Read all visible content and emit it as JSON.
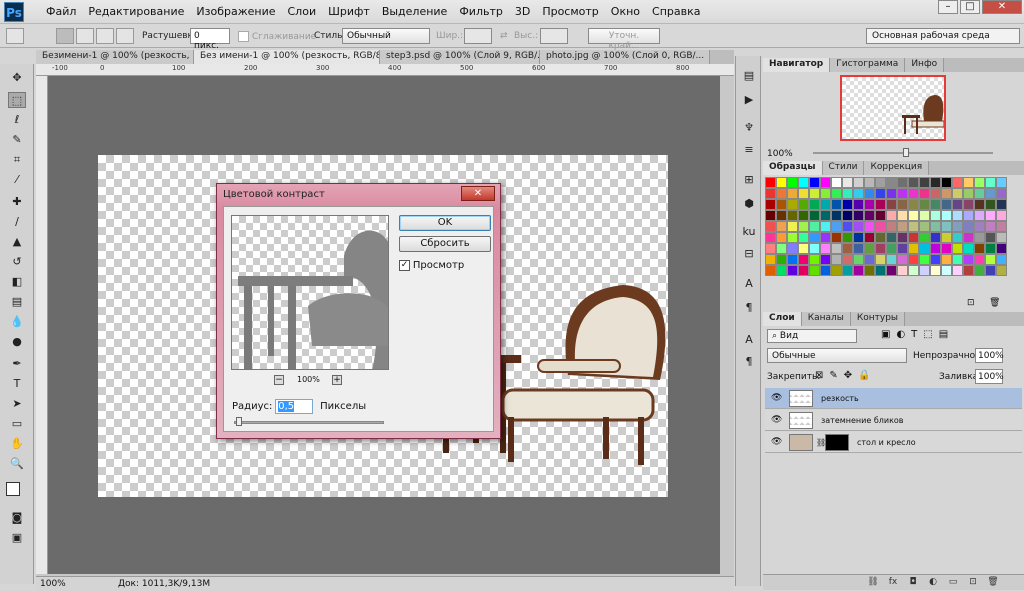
{
  "app": {
    "logo": "Ps"
  },
  "menu": [
    "Файл",
    "Редактирование",
    "Изображение",
    "Слои",
    "Шрифт",
    "Выделение",
    "Фильтр",
    "3D",
    "Просмотр",
    "Окно",
    "Справка"
  ],
  "window_controls": [
    "–",
    "□",
    "✕"
  ],
  "options_bar": {
    "feather_label": "Растушевка:",
    "feather_value": "0 пикс.",
    "antialias_label": "Сглаживание",
    "style_label": "Стиль:",
    "style_value": "Обычный",
    "width_label": "Шир.:",
    "height_label": "Выс.:",
    "refine_label": "Уточн. край...",
    "workspace": "Основная рабочая среда"
  },
  "doc_tabs": [
    "Безимени-1 @ 100% (резкость, ...",
    "Без имени-1 @ 100% (резкость, RGB/8) *",
    "step3.psd @ 100% (Слой 9, RGB/...",
    "photo.jpg @ 100% (Слой 0, RGB/..."
  ],
  "ruler_top_ticks": [
    "-100",
    "0",
    "100",
    "200",
    "300",
    "400",
    "500",
    "600",
    "700",
    "800"
  ],
  "status": {
    "zoom": "100%",
    "doc_info": "Док: 1011,3K/9,13M"
  },
  "dialog": {
    "title": "Цветовой контраст",
    "ok": "OK",
    "reset": "Сбросить",
    "preview_label": "Просмотр",
    "preview_checked": "✓",
    "zoom": "100%",
    "radius_label": "Радиус:",
    "radius_value": "0,5",
    "radius_unit": "Пикселы"
  },
  "navigator": {
    "tabs": [
      "Навигатор",
      "Гистограмма",
      "Инфо"
    ],
    "zoom": "100%"
  },
  "swatch_panel": {
    "tabs": [
      "Образцы",
      "Стили",
      "Коррекция"
    ]
  },
  "swatches": [
    "#ff0000",
    "#ffff00",
    "#00ff00",
    "#00ffff",
    "#0000ff",
    "#ff00ff",
    "#ffffff",
    "#e8e8e8",
    "#d0d0d0",
    "#b8b8b8",
    "#a0a0a0",
    "#888888",
    "#707070",
    "#585858",
    "#404040",
    "#282828",
    "#000000",
    "#ff6666",
    "#ffcc66",
    "#99ff66",
    "#66ffcc",
    "#66ccff",
    "#ee3333",
    "#ee7733",
    "#eeaa33",
    "#eedd33",
    "#ccee33",
    "#88ee33",
    "#33ee55",
    "#33eebb",
    "#33ccee",
    "#3388ee",
    "#3344ee",
    "#7733ee",
    "#bb33ee",
    "#ee33cc",
    "#ee3388",
    "#cc6666",
    "#cc9966",
    "#cccc66",
    "#99cc66",
    "#66cc99",
    "#6699cc",
    "#9966cc",
    "#aa0000",
    "#aa5500",
    "#aaaa00",
    "#55aa00",
    "#00aa55",
    "#00aaaa",
    "#0055aa",
    "#0000aa",
    "#5500aa",
    "#aa00aa",
    "#aa0055",
    "#884444",
    "#886644",
    "#888844",
    "#668844",
    "#448866",
    "#446688",
    "#664488",
    "#884466",
    "#553322",
    "#335522",
    "#223355",
    "#660000",
    "#663300",
    "#666600",
    "#336600",
    "#006633",
    "#006666",
    "#003366",
    "#000066",
    "#330066",
    "#660066",
    "#660033",
    "#ffaaaa",
    "#ffddaa",
    "#ffffaa",
    "#ddffaa",
    "#aaffdd",
    "#aaffff",
    "#aaddff",
    "#aaaaff",
    "#ddaaff",
    "#ffaaff",
    "#ffaadd",
    "#f05050",
    "#f0a050",
    "#f0f050",
    "#a0f050",
    "#50f0a0",
    "#50f0f0",
    "#50a0f0",
    "#5050f0",
    "#a050f0",
    "#f050f0",
    "#f050a0",
    "#c08080",
    "#c0a080",
    "#c0c080",
    "#a0c080",
    "#80c0a0",
    "#80c0c0",
    "#80a0c0",
    "#8080c0",
    "#a080c0",
    "#c080c0",
    "#c080a0",
    "#ff3399",
    "#ff9933",
    "#99ff33",
    "#33ff99",
    "#3399ff",
    "#9933ff",
    "#993300",
    "#339900",
    "#003399",
    "#990033",
    "#666633",
    "#336666",
    "#663366",
    "#cc3333",
    "#33cc33",
    "#3333cc",
    "#cccc33",
    "#33cccc",
    "#cc33cc",
    "#999999",
    "#555555",
    "#bbbbbb",
    "#ff8080",
    "#80ff80",
    "#8080ff",
    "#ffff80",
    "#80ffff",
    "#ff80ff",
    "#c0c0c0",
    "#a06040",
    "#4060a0",
    "#60a040",
    "#a04060",
    "#40a060",
    "#6040a0",
    "#e0c000",
    "#00c0e0",
    "#c000e0",
    "#e000c0",
    "#c0e000",
    "#00e0c0",
    "#804000",
    "#008040",
    "#400080",
    "#f2b200",
    "#2ab200",
    "#0072f2",
    "#f20072",
    "#72f200",
    "#7200f2",
    "#b2b2b2",
    "#d46a6a",
    "#6ad46a",
    "#6a6ad4",
    "#d4d46a",
    "#6ad4d4",
    "#d46ad4",
    "#ff4040",
    "#40ff40",
    "#4040ff",
    "#ffb040",
    "#40ffb0",
    "#b040ff",
    "#ff40b0",
    "#b0ff40",
    "#40b0ff",
    "#e06000",
    "#00e060",
    "#6000e0",
    "#e00060",
    "#60e000",
    "#0060e0",
    "#a0a000",
    "#00a0a0",
    "#a000a0",
    "#707000",
    "#007070",
    "#700070",
    "#ffd0d0",
    "#d0ffd0",
    "#d0d0ff",
    "#ffffd0",
    "#d0ffff",
    "#ffd0ff",
    "#b04040",
    "#40b040",
    "#4040b0",
    "#b0b040"
  ],
  "layers_panel": {
    "tabs": [
      "Слои",
      "Каналы",
      "Контуры"
    ],
    "kind_label": "Вид",
    "blend_mode": "Обычные",
    "opacity_label": "Непрозрачность:",
    "opacity_value": "100%",
    "lock_label": "Закрепить:",
    "fill_label": "Заливка:",
    "fill_value": "100%",
    "layers": [
      "резкость",
      "затемнение бликов",
      "стол и кресло"
    ]
  }
}
